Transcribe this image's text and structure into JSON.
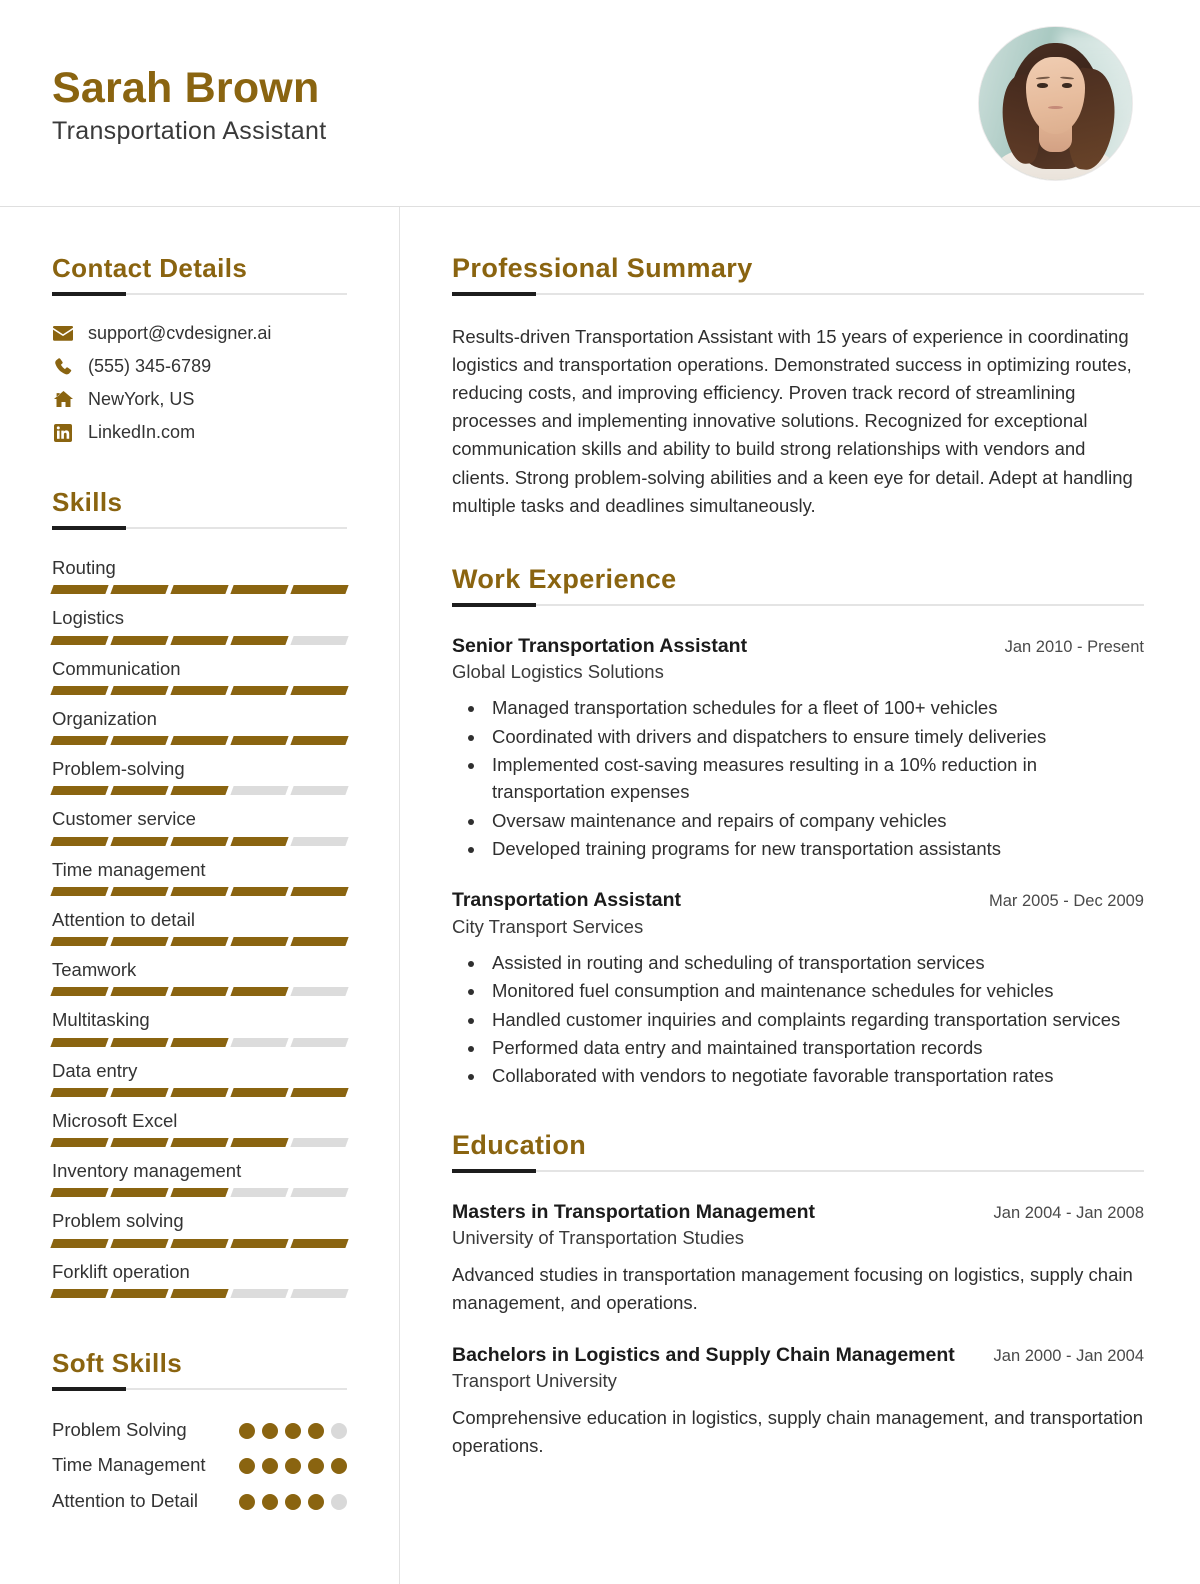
{
  "header": {
    "full_name": "Sarah Brown",
    "job_title": "Transportation Assistant",
    "avatar_alt": "profile-photo"
  },
  "theme": {
    "accent": "#8a6410",
    "accent_dark": "#1d1d1d",
    "muted": "#dcdcdc",
    "text": "#2f2f2f"
  },
  "sidebar": {
    "contact": {
      "title": "Contact Details",
      "items": [
        {
          "icon": "envelope-icon",
          "value": "support@cvdesigner.ai"
        },
        {
          "icon": "phone-icon",
          "value": "(555) 345-6789"
        },
        {
          "icon": "home-icon",
          "value": "NewYork, US"
        },
        {
          "icon": "linkedin-icon",
          "value": "LinkedIn.com"
        }
      ]
    },
    "skills": {
      "title": "Skills",
      "max": 5,
      "items": [
        {
          "name": "Routing",
          "level": 5
        },
        {
          "name": "Logistics",
          "level": 4
        },
        {
          "name": "Communication",
          "level": 5
        },
        {
          "name": "Organization",
          "level": 5
        },
        {
          "name": "Problem-solving",
          "level": 3
        },
        {
          "name": "Customer service",
          "level": 4
        },
        {
          "name": "Time management",
          "level": 5
        },
        {
          "name": "Attention to detail",
          "level": 5
        },
        {
          "name": "Teamwork",
          "level": 4
        },
        {
          "name": "Multitasking",
          "level": 3
        },
        {
          "name": "Data entry",
          "level": 5
        },
        {
          "name": "Microsoft Excel",
          "level": 4
        },
        {
          "name": "Inventory management",
          "level": 3
        },
        {
          "name": "Problem solving",
          "level": 5
        },
        {
          "name": "Forklift operation",
          "level": 3
        }
      ]
    },
    "soft_skills": {
      "title": "Soft Skills",
      "max": 5,
      "items": [
        {
          "name": "Problem Solving",
          "level": 4
        },
        {
          "name": "Time Management",
          "level": 5
        },
        {
          "name": "Attention to Detail",
          "level": 4
        }
      ]
    }
  },
  "main": {
    "summary": {
      "title": "Professional Summary",
      "text": "Results-driven Transportation Assistant with 15 years of experience in coordinating logistics and transportation operations. Demonstrated success in optimizing routes, reducing costs, and improving efficiency. Proven track record of streamlining processes and implementing innovative solutions. Recognized for exceptional communication skills and ability to build strong relationships with vendors and clients. Strong problem-solving abilities and a keen eye for detail. Adept at handling multiple tasks and deadlines simultaneously."
    },
    "work": {
      "title": "Work Experience",
      "entries": [
        {
          "position": "Senior Transportation Assistant",
          "company": "Global Logistics Solutions",
          "date": "Jan 2010 - Present",
          "bullets": [
            "Managed transportation schedules for a fleet of 100+ vehicles",
            "Coordinated with drivers and dispatchers to ensure timely deliveries",
            "Implemented cost-saving measures resulting in a 10% reduction in transportation expenses",
            "Oversaw maintenance and repairs of company vehicles",
            "Developed training programs for new transportation assistants"
          ]
        },
        {
          "position": "Transportation Assistant",
          "company": "City Transport Services",
          "date": "Mar 2005 - Dec 2009",
          "bullets": [
            "Assisted in routing and scheduling of transportation services",
            "Monitored fuel consumption and maintenance schedules for vehicles",
            "Handled customer inquiries and complaints regarding transportation services",
            "Performed data entry and maintained transportation records",
            "Collaborated with vendors to negotiate favorable transportation rates"
          ]
        }
      ]
    },
    "education": {
      "title": "Education",
      "entries": [
        {
          "degree": "Masters in Transportation Management",
          "school": "University of Transportation Studies",
          "date": "Jan 2004 - Jan 2008",
          "description": "Advanced studies in transportation management focusing on logistics, supply chain management, and operations."
        },
        {
          "degree": "Bachelors in Logistics and Supply Chain Management",
          "school": "Transport University",
          "date": "Jan 2000 - Jan 2004",
          "description": "Comprehensive education in logistics, supply chain management, and transportation operations."
        }
      ]
    }
  }
}
